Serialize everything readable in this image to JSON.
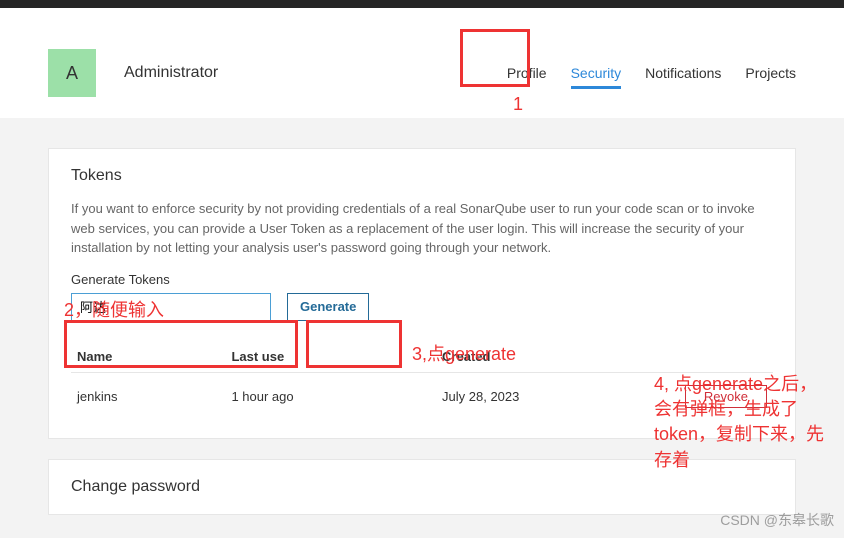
{
  "header": {
    "avatar_letter": "A",
    "username": "Administrator",
    "tabs": [
      {
        "label": "Profile",
        "active": false
      },
      {
        "label": "Security",
        "active": true
      },
      {
        "label": "Notifications",
        "active": false
      },
      {
        "label": "Projects",
        "active": false
      }
    ]
  },
  "tokens_panel": {
    "title": "Tokens",
    "description": "If you want to enforce security by not providing credentials of a real SonarQube user to run your code scan or to invoke web services, you can provide a User Token as a replacement of the user login. This will increase the security of your installation by not letting your analysis user's password going through your network.",
    "generate_label": "Generate Tokens",
    "input_value": "阿达",
    "generate_button": "Generate",
    "columns": {
      "name": "Name",
      "last_use": "Last use",
      "created": "Created"
    },
    "rows": [
      {
        "name": "jenkins",
        "last_use": "1 hour ago",
        "created": "July 28, 2023",
        "revoke": "Revoke"
      }
    ]
  },
  "change_pw_panel": {
    "title": "Change password"
  },
  "annotations": {
    "step1": "1",
    "step2": "2，随便输入",
    "step3": "3,点generate",
    "step4": "4, 点generate之后，会有弹框，生成了token，复制下来，先存着"
  },
  "watermark": "CSDN @东皋长歌"
}
